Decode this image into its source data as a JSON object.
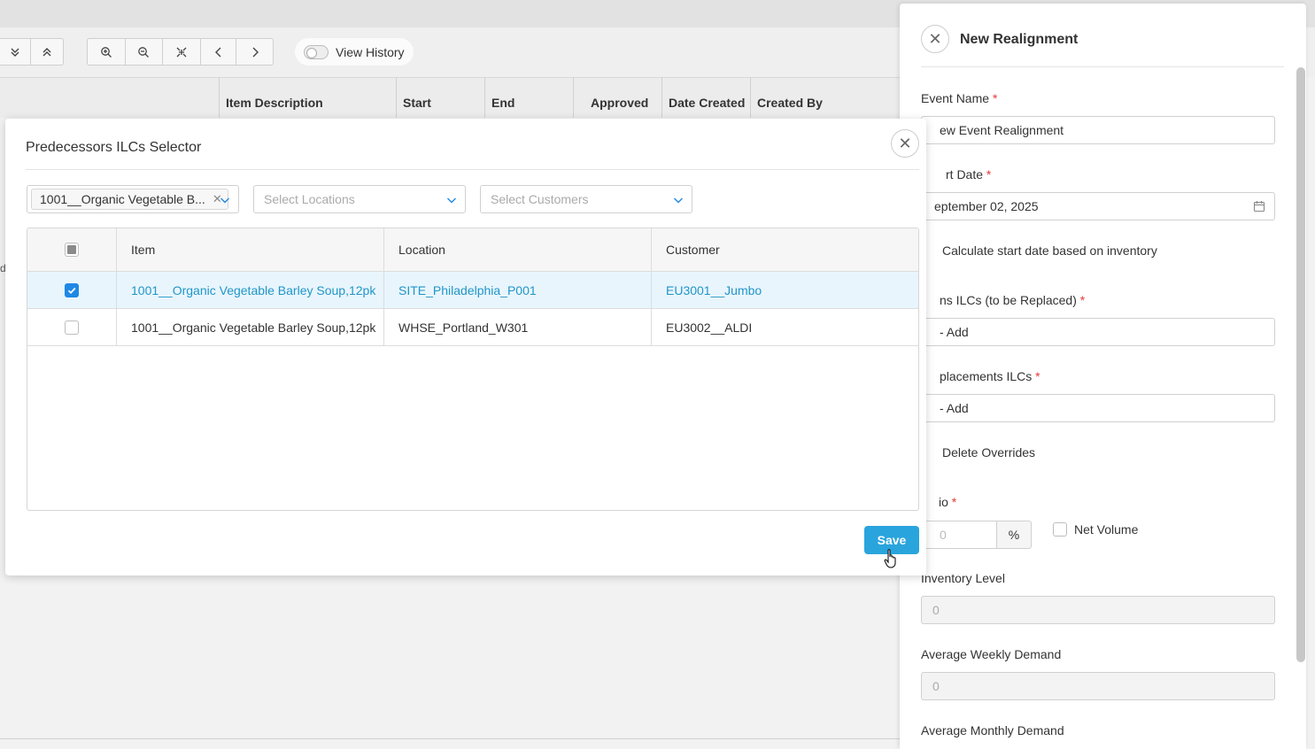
{
  "background": {
    "view_history_label": "View History",
    "columns": [
      "Item Description",
      "Start",
      "End",
      "Approved",
      "Date Created",
      "Created By"
    ],
    "side_fragment": "d"
  },
  "modal": {
    "title": "Predecessors ILCs Selector",
    "close_icon": "close-icon",
    "filters": {
      "item_chip": "1001__Organic Vegetable B...",
      "locations_placeholder": "Select Locations",
      "customers_placeholder": "Select Customers"
    },
    "grid": {
      "headers": [
        "Item",
        "Location",
        "Customer"
      ],
      "rows": [
        {
          "selected": true,
          "item": "1001__Organic Vegetable Barley Soup,12pk",
          "location": "SITE_Philadelphia_P001",
          "customer": "EU3001__Jumbo"
        },
        {
          "selected": false,
          "item": "1001__Organic Vegetable Barley Soup,12pk",
          "location": "WHSE_Portland_W301",
          "customer": "EU3002__ALDI"
        }
      ]
    },
    "save_label": "Save",
    "accent_color": "#29a4dd"
  },
  "panel": {
    "title": "New Realignment",
    "event_name_label": "Event Name",
    "event_name_value": "ew Event Realignment",
    "start_date_label": "rt Date",
    "start_date_value": "eptember 02, 2025",
    "calc_start_label": "Calculate start date based on inventory",
    "predecessors_label": "ns ILCs (to be Replaced)",
    "predecessors_add": "- Add",
    "replacements_label": "placements ILCs",
    "replacements_add": "- Add",
    "delete_overrides_label": "Delete Overrides",
    "ratio_label": "io",
    "ratio_value": "0",
    "percent_symbol": "%",
    "net_volume_label": "Net Volume",
    "inventory_label": "Inventory Level",
    "inventory_value": "0",
    "avg_weekly_label": "Average Weekly Demand",
    "avg_weekly_value": "0",
    "avg_monthly_label": "Average Monthly Demand",
    "required_mark": "*"
  }
}
